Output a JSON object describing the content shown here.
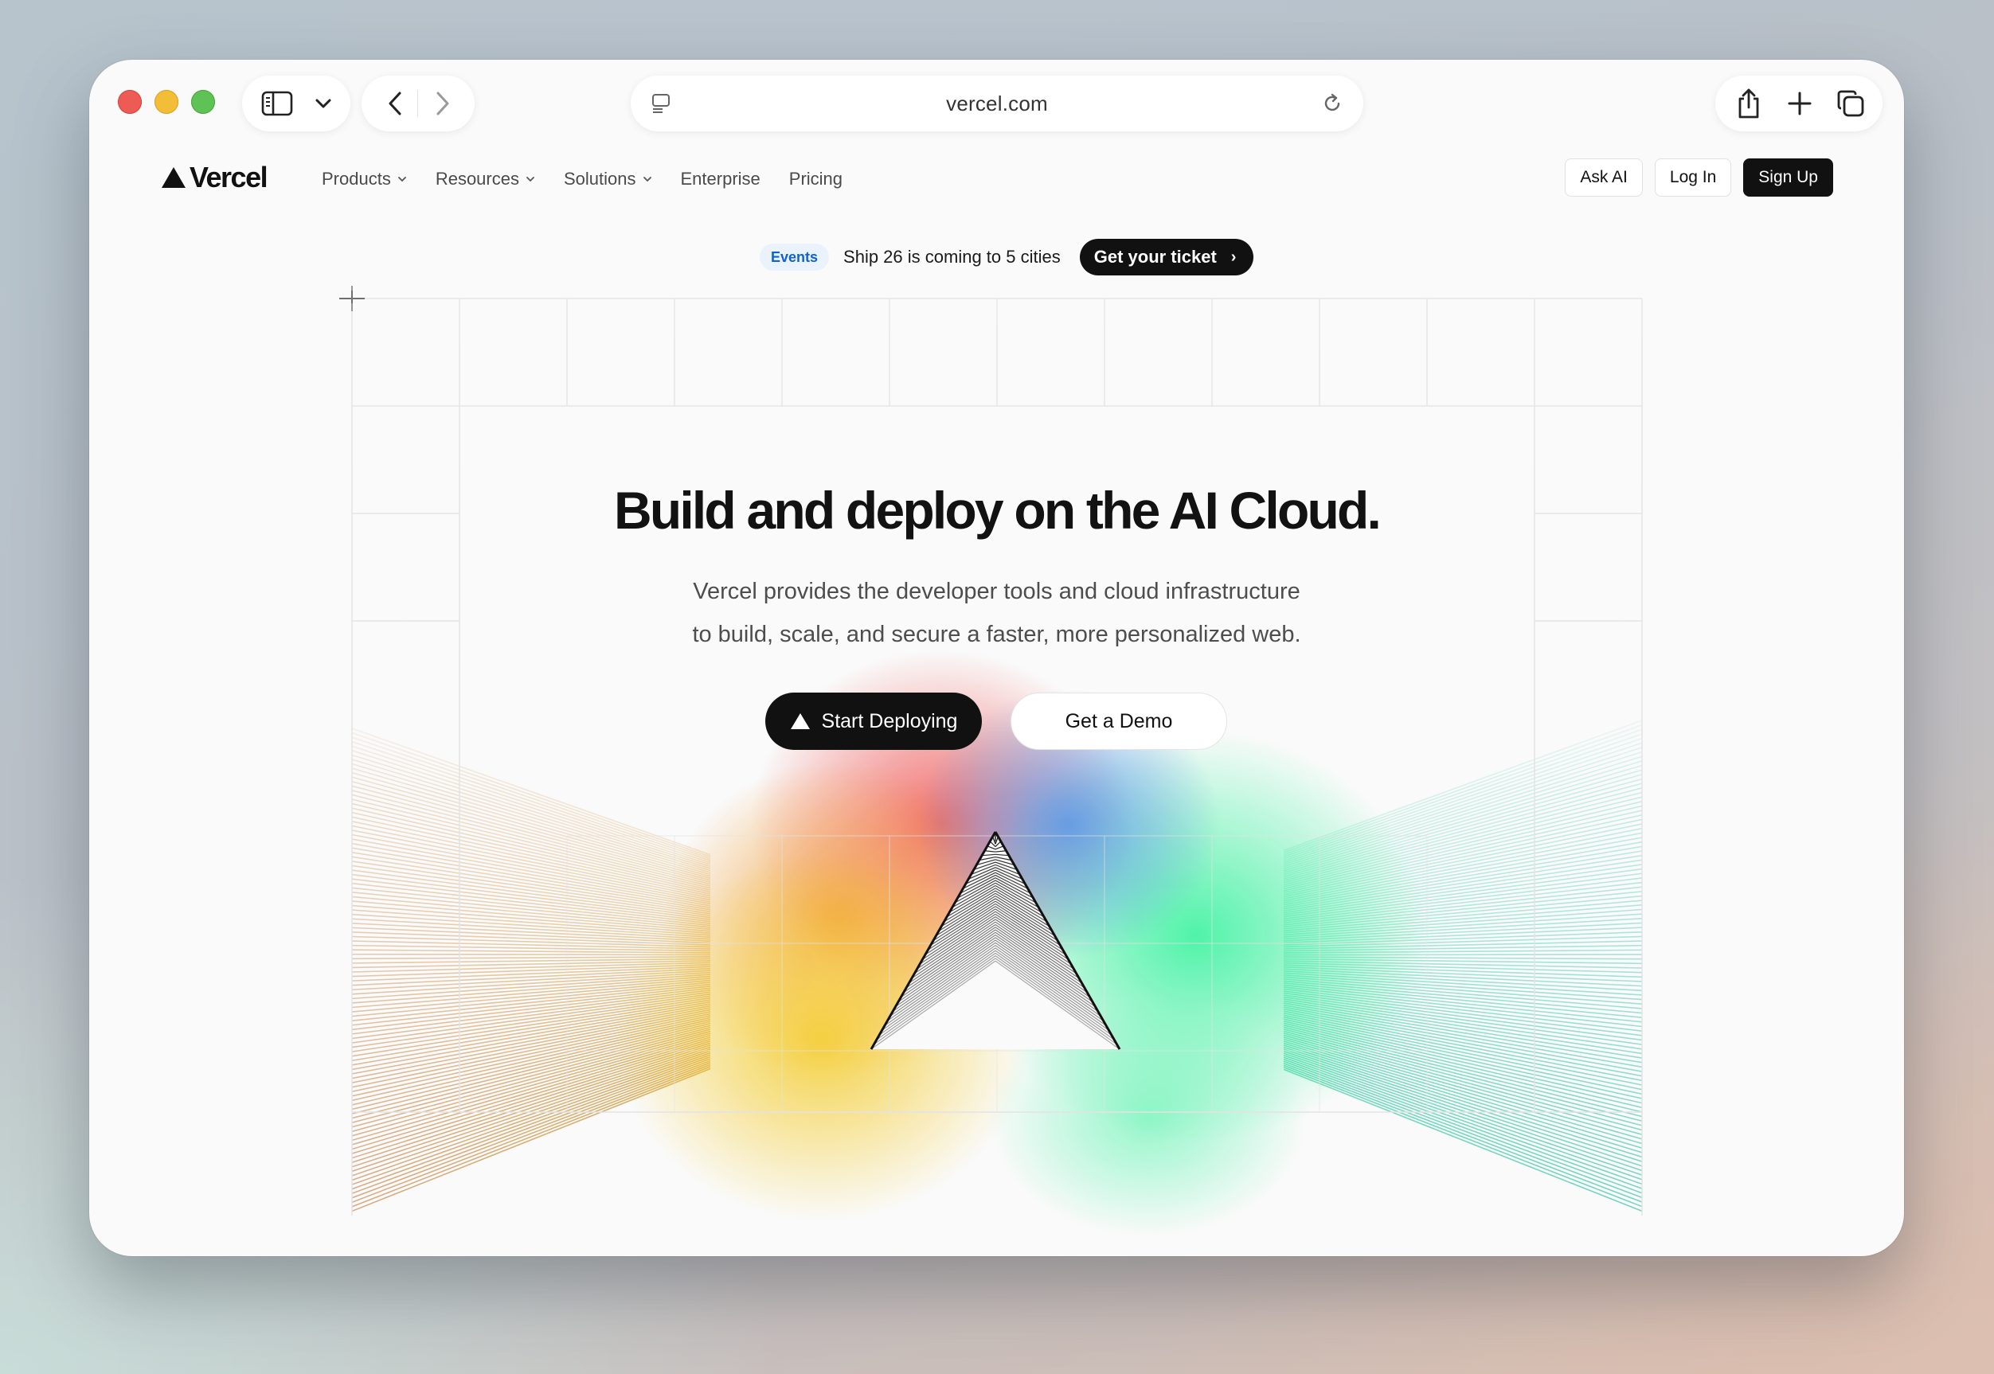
{
  "browser": {
    "url": "vercel.com",
    "icons": [
      "sidebar-icon",
      "chevron-down-icon",
      "back-icon",
      "forward-icon",
      "reader-icon",
      "reload-icon",
      "share-icon",
      "plus-icon",
      "tabs-icon"
    ]
  },
  "nav": {
    "logo_text": "Vercel",
    "menu": [
      {
        "label": "Products",
        "has_dropdown": true
      },
      {
        "label": "Resources",
        "has_dropdown": true
      },
      {
        "label": "Solutions",
        "has_dropdown": true
      },
      {
        "label": "Enterprise",
        "has_dropdown": false
      },
      {
        "label": "Pricing",
        "has_dropdown": false
      }
    ],
    "ask_ai": "Ask AI",
    "log_in": "Log In",
    "sign_up": "Sign Up"
  },
  "banner": {
    "badge": "Events",
    "text": "Ship 26 is coming to 5 cities",
    "cta": "Get your ticket"
  },
  "hero": {
    "title": "Build and deploy on the AI Cloud.",
    "subtitle_line1": "Vercel provides the developer tools and cloud infrastructure",
    "subtitle_line2": "to build, scale, and secure a faster, more personalized web.",
    "primary_cta": "Start Deploying",
    "secondary_cta": "Get a Demo"
  },
  "colors": {
    "accent_dark": "#111111",
    "badge_blue": "#0f62d6",
    "glow_red": "#ef4b4b",
    "glow_orange": "#f19a2e",
    "glow_yellow": "#f4cc2f",
    "glow_green": "#3df2a0",
    "glow_blue": "#4c8ee8",
    "rays_left": "#d69a55",
    "rays_right": "#4fd6ac"
  }
}
